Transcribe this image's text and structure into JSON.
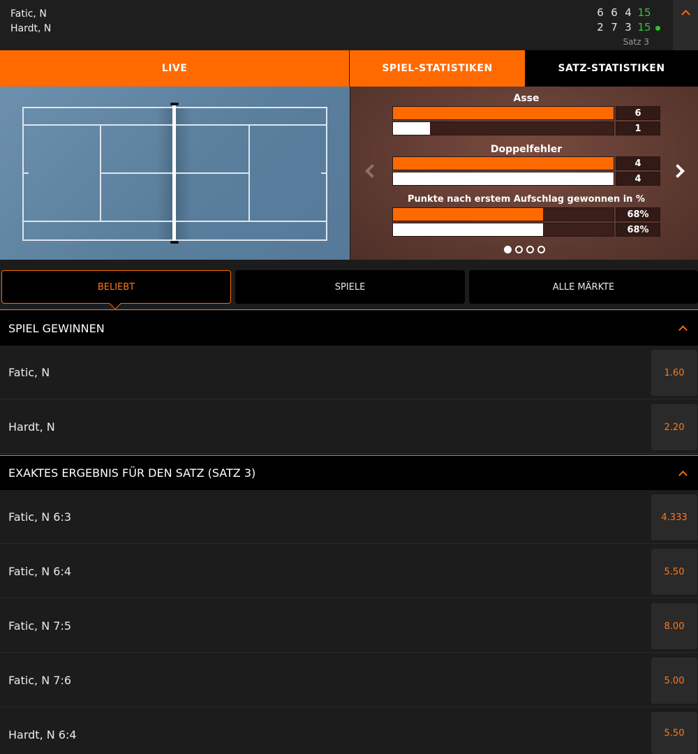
{
  "header": {
    "players": [
      "Fatic, N",
      "Hardt, N"
    ],
    "scores": [
      {
        "sets": [
          "6",
          "6",
          "4"
        ],
        "points": "15",
        "serving": false
      },
      {
        "sets": [
          "2",
          "7",
          "3"
        ],
        "points": "15",
        "serving": true
      }
    ],
    "set_label": "Satz 3"
  },
  "tabs": [
    "LIVE",
    "SPIEL-STATISTIKEN",
    "SATZ-STATISTIKEN"
  ],
  "stats": {
    "items": [
      {
        "title": "Asse",
        "p1": {
          "value": "6",
          "fraction": 1.0
        },
        "p2": {
          "value": "1",
          "fraction": 0.167
        }
      },
      {
        "title": "Doppelfehler",
        "p1": {
          "value": "4",
          "fraction": 1.0
        },
        "p2": {
          "value": "4",
          "fraction": 1.0
        }
      },
      {
        "title": "Punkte nach erstem Aufschlag gewonnen in %",
        "p1": {
          "value": "68%",
          "fraction": 0.68
        },
        "p2": {
          "value": "68%",
          "fraction": 0.68
        }
      }
    ],
    "page_count": 4,
    "active_page": 1
  },
  "filters": [
    "BELIEBT",
    "SPIELE",
    "ALLE MÄRKTE"
  ],
  "markets": [
    {
      "title": "SPIEL GEWINNEN",
      "selections": [
        {
          "name": "Fatic, N",
          "odds": "1.60"
        },
        {
          "name": "Hardt, N",
          "odds": "2.20"
        }
      ]
    },
    {
      "title": "EXAKTES ERGEBNIS FÜR DEN SATZ (SATZ 3)",
      "selections": [
        {
          "name": "Fatic, N 6:3",
          "odds": "4.333"
        },
        {
          "name": "Fatic, N 6:4",
          "odds": "5.50"
        },
        {
          "name": "Fatic, N 7:5",
          "odds": "8.00"
        },
        {
          "name": "Fatic, N 7:6",
          "odds": "5.00"
        },
        {
          "name": "Hardt, N 6:4",
          "odds": "5.50"
        }
      ]
    }
  ],
  "colors": {
    "accent": "#ff6a00",
    "serve_indicator": "#28c828",
    "points": "#3fbf3f"
  }
}
